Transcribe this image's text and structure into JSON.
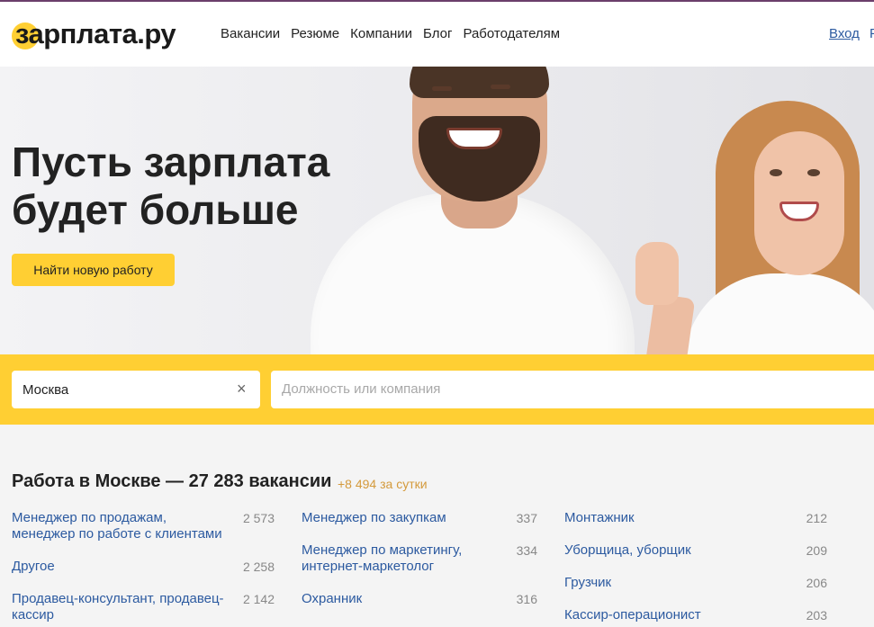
{
  "header": {
    "logo_text": "зарплата.ру",
    "nav": [
      "Вакансии",
      "Резюме",
      "Компании",
      "Блог",
      "Работодателям"
    ],
    "login_label": "Вход",
    "extra_label": "Р"
  },
  "hero": {
    "title_line1": "Пусть зарплата",
    "title_line2": "будет больше",
    "cta_label": "Найти новую работу"
  },
  "search": {
    "city_value": "Москва",
    "clear_icon": "×",
    "query_placeholder": "Должность или компания"
  },
  "listing": {
    "title": "Работа в Москве — 27 283 вакансии",
    "delta": "+8 494 за сутки",
    "columns": [
      [
        {
          "label": "Менеджер по продажам, менеджер по работе с клиентами",
          "count": "2 573"
        },
        {
          "label": "Другое",
          "count": "2 258"
        },
        {
          "label": "Продавец-консультант, продавец-кассир",
          "count": "2 142"
        }
      ],
      [
        {
          "label": "Менеджер по закупкам",
          "count": "337"
        },
        {
          "label": "Менеджер по маркетингу, интернет-маркетолог",
          "count": "334"
        },
        {
          "label": "Охранник",
          "count": "316"
        }
      ],
      [
        {
          "label": "Монтажник",
          "count": "212"
        },
        {
          "label": "Уборщица, уборщик",
          "count": "209"
        },
        {
          "label": "Грузчик",
          "count": "206"
        },
        {
          "label": "Кассир-операционист",
          "count": "203"
        }
      ]
    ]
  },
  "colors": {
    "accent": "#ffcf33",
    "link": "#2c5aa0",
    "delta": "#d49a3c"
  }
}
